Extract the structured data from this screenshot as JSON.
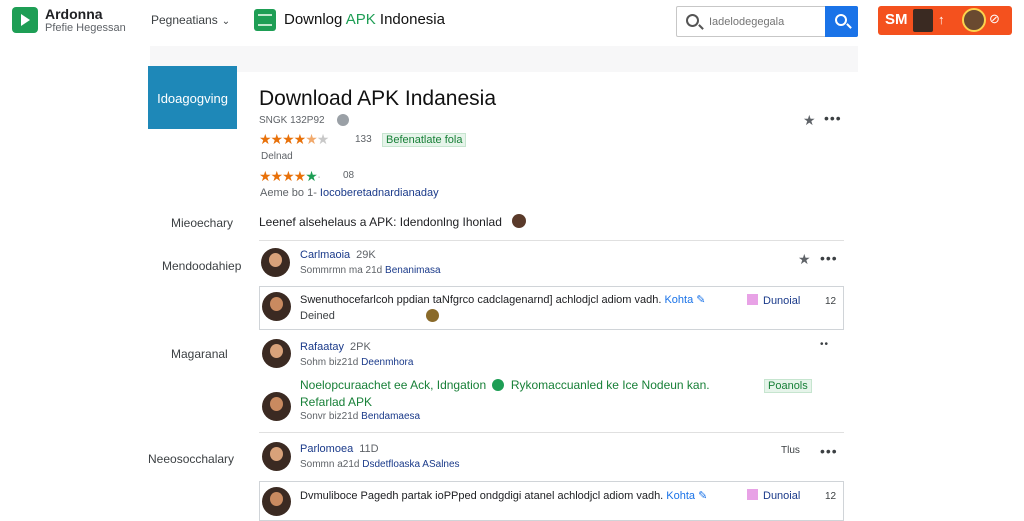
{
  "header": {
    "brand_title": "Ardonna",
    "brand_subtitle": "Pfefie Hegessan",
    "nav_menu": "Pegneatians",
    "app_title_prefix": "Downlog ",
    "app_title_highlight": "APK",
    "app_title_suffix": " Indonesia",
    "search_placeholder": "Iadelodegegala",
    "promo_label": "SM",
    "promo_arrow": "↑",
    "promo_icon": "⊘"
  },
  "hero": {
    "tile_label": "Idoagogving",
    "title": "Download APK Indanesia",
    "meta": "SNGK 132P92",
    "rating_count": "133",
    "badge": "Befenatlate fola",
    "sub": "Delnad",
    "rating2_count": "08",
    "meta2_prefix": "Aeme bo 1- ",
    "meta2_link": "Iocoberetadnardianaday"
  },
  "sidebar": {
    "labels": [
      "Mieoechary",
      "Mendoodahiep",
      "Magaranal",
      "Neeosocchalary"
    ]
  },
  "description": {
    "text": "Leenef alsehelaus a APK: Idendonlng Ihonlad"
  },
  "comments": [
    {
      "name": "Carlmaoia",
      "count": "29K",
      "subline_prefix": "Sommrmn ma 21d ",
      "subline_link": "Benanimasa"
    },
    {
      "text_prefix": "Swenuthocefarlcoh ppdian taNfgrco cadclagenarnd] achlodjcl adiom vadh. ",
      "text_link": "Kohta",
      "tag": "Dunoial",
      "line2": "Deined",
      "count": "12"
    },
    {
      "name": "Rafaatay",
      "count": "2PK",
      "subline_prefix": "Sohm biz21d ",
      "subline_link": "Deenmhora",
      "green_prefix": "Noelopcuraachet ee Ack, Idngation",
      "green_suffix": "Rykomaccuanled ke Ice Nodeun kan.",
      "green_badge": "Poanols",
      "green_line2": "Refarlad APK"
    },
    {
      "subline_prefix": "Sonvr biz21d ",
      "subline_link": "Bendamaesa"
    },
    {
      "name": "Parlomoea",
      "count": "11D",
      "subline_prefix": "Sommn a21d ",
      "subline_link": "Dsdetfloaska ASalnes",
      "right_count": "Tlus"
    },
    {
      "text_prefix": "Dvmuliboce Pagedh partak ioPPped ondgdigi atanel achlodjcl adiom vadh. ",
      "text_link": "Kohta",
      "tag": "Dunoial",
      "count": "12"
    }
  ],
  "colors": {
    "brand_green": "#1e9e55",
    "search_blue": "#1a73e8",
    "promo_orange": "#f4511e",
    "hero_blue": "#1e88b8",
    "star_orange": "#e8710a"
  }
}
